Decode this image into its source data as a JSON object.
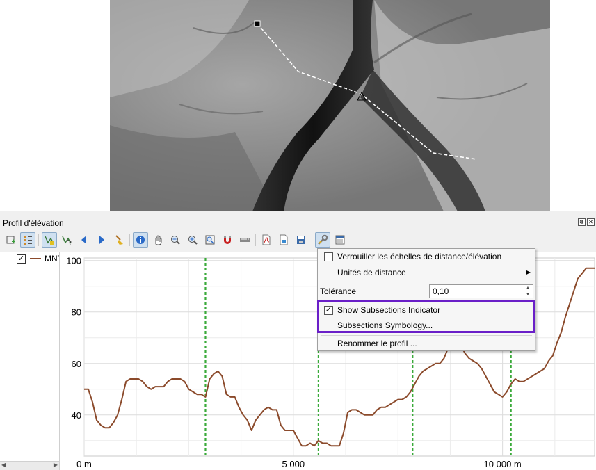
{
  "panel": {
    "title": "Profil d'élévation"
  },
  "toolbar": {
    "buttons": [
      {
        "name": "add-layers-icon",
        "active": false
      },
      {
        "name": "layer-tree-icon",
        "active": true
      },
      {
        "name": "capture-curve-icon",
        "active": true
      },
      {
        "name": "capture-from-feature-icon",
        "active": false
      },
      {
        "name": "undo-icon",
        "active": false
      },
      {
        "name": "redo-icon",
        "active": false
      },
      {
        "name": "clear-icon",
        "active": false
      },
      {
        "name": "identify-icon",
        "active": true
      },
      {
        "name": "pan-icon",
        "active": false
      },
      {
        "name": "zoom-x-icon",
        "active": false
      },
      {
        "name": "zoom-in-icon",
        "active": false
      },
      {
        "name": "zoom-full-icon",
        "active": false
      },
      {
        "name": "snapping-icon",
        "active": false
      },
      {
        "name": "distance-icon",
        "active": false
      },
      {
        "name": "export-pdf-icon",
        "active": false
      },
      {
        "name": "export-image-icon",
        "active": false
      },
      {
        "name": "export-3d-icon",
        "active": false
      },
      {
        "name": "options-icon",
        "active": true
      },
      {
        "name": "dock-icon",
        "active": false
      }
    ]
  },
  "legend": {
    "layer": {
      "label": "MNT",
      "checked": true,
      "color": "#8b4a2b"
    }
  },
  "menu": {
    "lock_scales": "Verrouiller les échelles de distance/élévation",
    "distance_units": "Unités de distance",
    "tolerance_label": "Tolérance",
    "tolerance_value": "0,10",
    "show_subsections": "Show Subsections Indicator",
    "show_subsections_checked": true,
    "subsections_symbology": "Subsections Symbology...",
    "rename_profile": "Renommer le profil ..."
  },
  "colors": {
    "profile": "#8b4a2b",
    "subsection": "#3aaa3a",
    "highlight": "#6a1fc8"
  },
  "chart_data": {
    "type": "line",
    "x_tick_labels": [
      "0 m",
      "5 000",
      "10 000 m"
    ],
    "x_ticks": [
      0,
      5000,
      10000
    ],
    "y_tick_labels": [
      "100",
      "80",
      "60",
      "40"
    ],
    "y_ticks": [
      100,
      80,
      60,
      40
    ],
    "xlim": [
      0,
      12200
    ],
    "ylim": [
      24,
      101
    ],
    "grid": true,
    "subsection_x": [
      2900,
      5600,
      7850,
      10200
    ],
    "series": [
      {
        "x": [
          0,
          100,
          200,
          300,
          400,
          500,
          600,
          700,
          800,
          900,
          1000,
          1100,
          1200,
          1300,
          1400,
          1500,
          1600,
          1700,
          1800,
          1900,
          2000,
          2100,
          2200,
          2300,
          2400,
          2500,
          2600,
          2700,
          2800,
          2900,
          3000,
          3100,
          3200,
          3300,
          3400,
          3500,
          3600,
          3700,
          3800,
          3900,
          4000,
          4100,
          4200,
          4300,
          4400,
          4500,
          4600,
          4700,
          4800,
          4900,
          5000,
          5100,
          5200,
          5300,
          5400,
          5500,
          5600,
          5700,
          5800,
          5900,
          6000,
          6100,
          6200,
          6300,
          6400,
          6500,
          6600,
          6700,
          6800,
          6900,
          7000,
          7100,
          7200,
          7300,
          7400,
          7500,
          7600,
          7700,
          7800,
          7900,
          8000,
          8100,
          8200,
          8300,
          8400,
          8500,
          8600,
          8700,
          8800,
          8900,
          9000,
          9100,
          9200,
          9300,
          9400,
          9500,
          9600,
          9700,
          9800,
          9900,
          10000,
          10100,
          10200,
          10300,
          10400,
          10500,
          10600,
          10700,
          10800,
          10900,
          11000,
          11100,
          11200,
          11300,
          11400,
          11500,
          11600,
          11700,
          11800,
          11900,
          12000,
          12100,
          12200
        ],
        "y": [
          50,
          50,
          45,
          38,
          36,
          35,
          35,
          37,
          40,
          46,
          53,
          54,
          54,
          54,
          53,
          51,
          50,
          51,
          51,
          51,
          53,
          54,
          54,
          54,
          53,
          50,
          49,
          48,
          48,
          47,
          54,
          56,
          57,
          55,
          48,
          47,
          47,
          43,
          40,
          38,
          34,
          38,
          40,
          42,
          43,
          42,
          42,
          36,
          34,
          34,
          34,
          31,
          28,
          28,
          29,
          28,
          30,
          29,
          29,
          28,
          28,
          28,
          33,
          41,
          42,
          42,
          41,
          40,
          40,
          40,
          42,
          43,
          43,
          44,
          45,
          46,
          46,
          47,
          49,
          52,
          55,
          57,
          58,
          59,
          60,
          60,
          62,
          66,
          67,
          68,
          67,
          64,
          62,
          61,
          60,
          58,
          55,
          52,
          49,
          48,
          47,
          49,
          52,
          54,
          53,
          53,
          54,
          55,
          56,
          57,
          58,
          61,
          63,
          68,
          72,
          78,
          83,
          88,
          93,
          95,
          97,
          97,
          97
        ]
      }
    ]
  }
}
